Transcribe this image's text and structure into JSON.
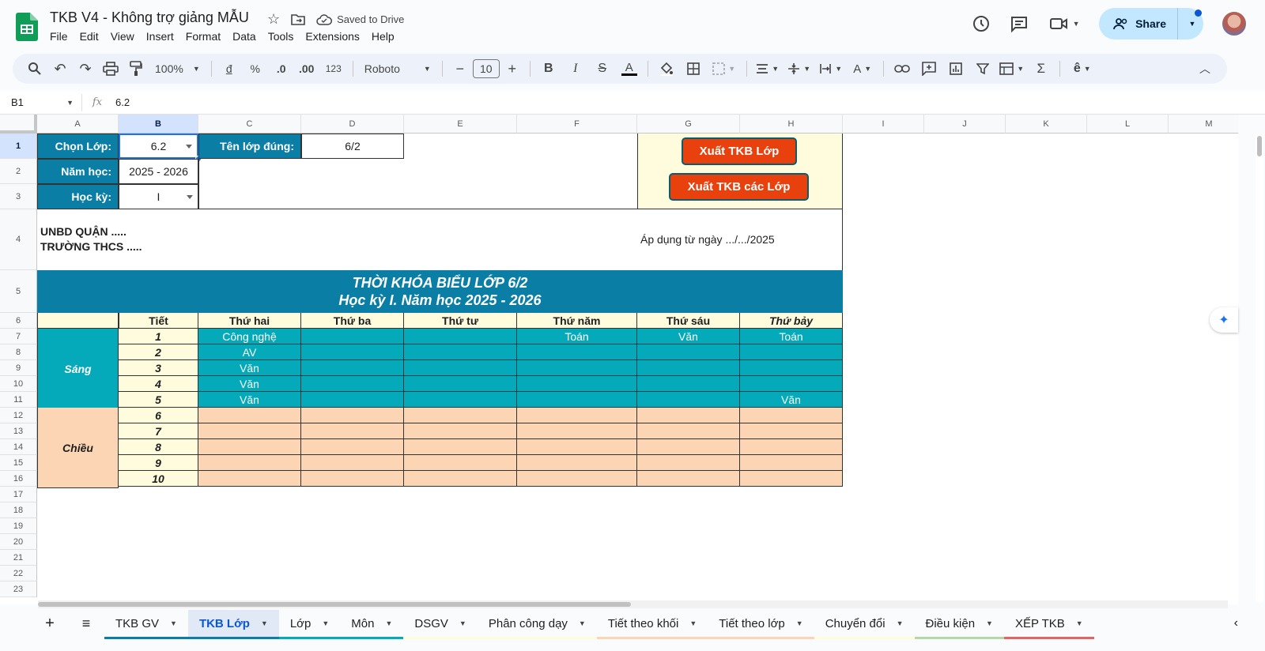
{
  "app": {
    "title": "TKB V4 - Không trợ giảng MẪU",
    "saved_status": "Saved to Drive",
    "menu": [
      "File",
      "Edit",
      "View",
      "Insert",
      "Format",
      "Data",
      "Tools",
      "Extensions",
      "Help"
    ],
    "share_label": "Share"
  },
  "toolbar": {
    "zoom": "100%",
    "currency": "đ",
    "percent": "%",
    "dec_decrease": ".0",
    "dec_increase": ".00",
    "number_format": "123",
    "font": "Roboto",
    "font_size": "10"
  },
  "formula_bar": {
    "name_box": "B1",
    "fx_label": "fx",
    "content": "6.2"
  },
  "columns": [
    "A",
    "B",
    "C",
    "D",
    "E",
    "F",
    "G",
    "H",
    "I",
    "J",
    "K",
    "L",
    "M"
  ],
  "rows": [
    "1",
    "2",
    "3",
    "4",
    "5",
    "6",
    "7",
    "8",
    "9",
    "10",
    "11",
    "12",
    "13",
    "14",
    "15",
    "16",
    "17",
    "18",
    "19",
    "20",
    "21",
    "22",
    "23"
  ],
  "sheet": {
    "choose_class_label": "Chọn Lớp:",
    "choose_class_value": "6.2",
    "correct_class_label": "Tên lớp đúng:",
    "correct_class_value": "6/2",
    "school_year_label": "Năm học:",
    "school_year_value": "2025 - 2026",
    "semester_label": "Học kỳ:",
    "semester_value": "I",
    "export_class_btn": "Xuất TKB Lớp",
    "export_all_btn": "Xuất TKB các Lớp",
    "unbd": "UNBD QUẬN .....",
    "school": "TRƯỜNG THCS .....",
    "apply_date": "Áp dụng từ ngày .../.../2025",
    "title_line1": "THỜI KHÓA BIỂU LỚP 6/2",
    "title_line2": "Học kỳ I. Năm học 2025 - 2026",
    "hdr_tiet": "Tiết",
    "days": [
      "Thứ hai",
      "Thứ ba",
      "Thứ tư",
      "Thứ năm",
      "Thứ sáu",
      "Thứ bảy"
    ],
    "morning_label": "Sáng",
    "afternoon_label": "Chiều",
    "morning_periods": [
      "1",
      "2",
      "3",
      "4",
      "5"
    ],
    "afternoon_periods": [
      "6",
      "7",
      "8",
      "9",
      "10"
    ],
    "morning": [
      [
        "Công nghệ",
        "",
        "",
        "Toán",
        "Văn",
        "Toán"
      ],
      [
        "AV",
        "",
        "",
        "",
        "",
        ""
      ],
      [
        "Văn",
        "",
        "",
        "",
        "",
        ""
      ],
      [
        "Văn",
        "",
        "",
        "",
        "",
        ""
      ],
      [
        "Văn",
        "",
        "",
        "",
        "",
        "Văn"
      ]
    ]
  },
  "tabs": [
    {
      "label": "TKB GV",
      "color": "#0b7ea6"
    },
    {
      "label": "TKB Lớp",
      "color": "#0b7ea6",
      "active": true
    },
    {
      "label": "Lớp",
      "color": "#04aab9"
    },
    {
      "label": "Môn",
      "color": "#04aab9"
    },
    {
      "label": "DSGV",
      "color": "#fefcdd"
    },
    {
      "label": "Phân công dạy",
      "color": "#fefcdd"
    },
    {
      "label": "Tiết theo khối",
      "color": "#fcd5b4"
    },
    {
      "label": "Tiết theo lớp",
      "color": "#fcd5b4"
    },
    {
      "label": "Chuyển đổi",
      "color": "#fefcdd"
    },
    {
      "label": "Điều kiện",
      "color": "#b6d7a8"
    },
    {
      "label": "XẾP TKB",
      "color": "#e06666"
    }
  ]
}
